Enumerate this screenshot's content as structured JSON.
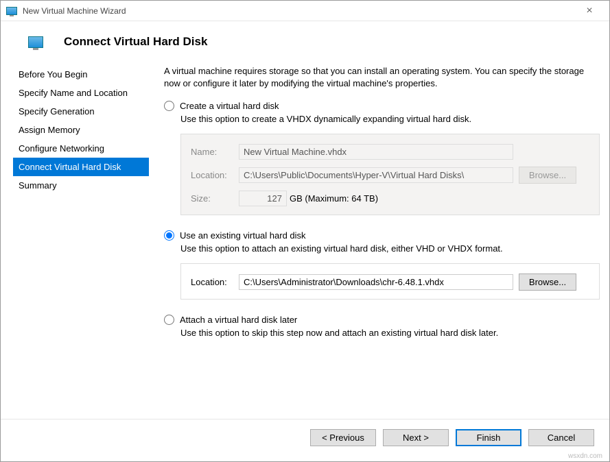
{
  "window": {
    "title": "New Virtual Machine Wizard",
    "heading": "Connect Virtual Hard Disk"
  },
  "sidebar": {
    "steps": [
      "Before You Begin",
      "Specify Name and Location",
      "Specify Generation",
      "Assign Memory",
      "Configure Networking",
      "Connect Virtual Hard Disk",
      "Summary"
    ],
    "activeIndex": 5
  },
  "intro": "A virtual machine requires storage so that you can install an operating system. You can specify the storage now or configure it later by modifying the virtual machine's properties.",
  "option_create": {
    "label": "Create a virtual hard disk",
    "desc": "Use this option to create a VHDX dynamically expanding virtual hard disk.",
    "name_label": "Name:",
    "name_value": "New Virtual Machine.vhdx",
    "location_label": "Location:",
    "location_value": "C:\\Users\\Public\\Documents\\Hyper-V\\Virtual Hard Disks\\",
    "browse_label": "Browse...",
    "size_label": "Size:",
    "size_value": "127",
    "size_unit": "GB (Maximum: 64 TB)"
  },
  "option_existing": {
    "label": "Use an existing virtual hard disk",
    "desc": "Use this option to attach an existing virtual hard disk, either VHD or VHDX format.",
    "location_label": "Location:",
    "location_value": "C:\\Users\\Administrator\\Downloads\\chr-6.48.1.vhdx",
    "browse_label": "Browse..."
  },
  "option_later": {
    "label": "Attach a virtual hard disk later",
    "desc": "Use this option to skip this step now and attach an existing virtual hard disk later."
  },
  "footer": {
    "previous": "< Previous",
    "next": "Next >",
    "finish": "Finish",
    "cancel": "Cancel"
  },
  "watermark": "wsxdn.com"
}
